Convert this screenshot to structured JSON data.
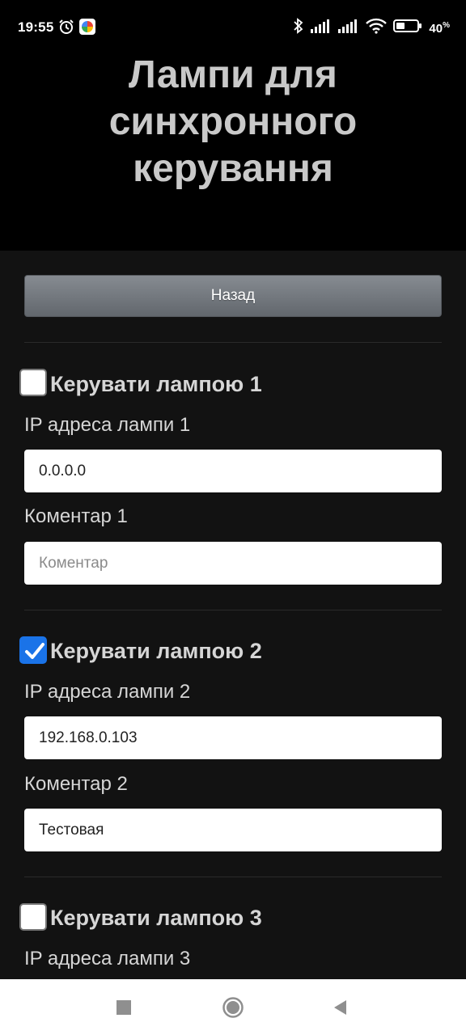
{
  "status_bar": {
    "time": "19:55",
    "battery_percent": "40",
    "battery_unit": "%",
    "battery_level": 0.4
  },
  "header": {
    "title": "Лампи для\nсинхронного\nкерування"
  },
  "back_button": {
    "label": "Назад"
  },
  "lamps": [
    {
      "checkbox_label": "Керувати лампою 1",
      "checked": false,
      "ip_label": "IP адреса лампи 1",
      "ip_value": "0.0.0.0",
      "comment_label": "Коментар 1",
      "comment_value": "",
      "comment_placeholder": "Коментар"
    },
    {
      "checkbox_label": "Керувати лампою 2",
      "checked": true,
      "ip_label": "IP адреса лампи 2",
      "ip_value": "192.168.0.103",
      "comment_label": "Коментар 2",
      "comment_value": "Тестовая",
      "comment_placeholder": "Коментар"
    },
    {
      "checkbox_label": "Керувати лампою 3",
      "checked": false,
      "ip_label": "IP адреса лампи 3"
    }
  ],
  "colors": {
    "background": "#121212",
    "header_background": "#000000",
    "checkbox_checked": "#1a73e8",
    "text": "#d6d6d6"
  },
  "nav_bar": {
    "recents_icon": "square-icon",
    "home_icon": "circle-icon",
    "back_icon": "triangle-left-icon"
  }
}
